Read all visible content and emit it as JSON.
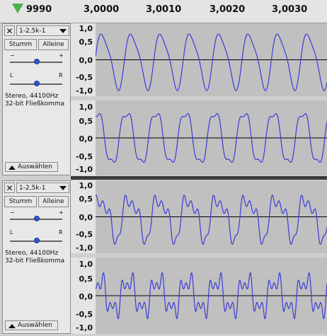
{
  "ruler": {
    "labels": [
      "9990",
      "3,0000",
      "3,0010",
      "3,0020",
      "3,0030"
    ]
  },
  "tracks": [
    {
      "name": "1-2,5k-1",
      "mute_label": "Stumm",
      "solo_label": "Alleine",
      "gain_minus": "−",
      "gain_plus": "+",
      "pan_left": "L",
      "pan_right": "R",
      "info_line1": "Stereo, 44100Hz",
      "info_line2": "32-bit Fließkomma",
      "select_label": "Auswählen",
      "scale": [
        "1,0",
        "0,5",
        "0,0",
        "-0,5",
        "-1,0"
      ]
    },
    {
      "name": "1-2,5k-1",
      "mute_label": "Stumm",
      "solo_label": "Alleine",
      "gain_minus": "−",
      "gain_plus": "+",
      "pan_left": "L",
      "pan_right": "R",
      "info_line1": "Stereo, 44100Hz",
      "info_line2": "32-bit Fließkomma",
      "select_label": "Auswählen",
      "scale": [
        "1,0",
        "0,5",
        "0,0",
        "-0,5",
        "-1,0"
      ]
    }
  ],
  "colors": {
    "waveform": "#3b3bd6",
    "wave_bg": "#c0c0c0",
    "panel": "#e8e8e8"
  },
  "icons": {
    "close": "close-icon",
    "menu": "chevron-down-icon",
    "collapse": "chevron-up-icon",
    "play_marker": "play-head-icon"
  }
}
